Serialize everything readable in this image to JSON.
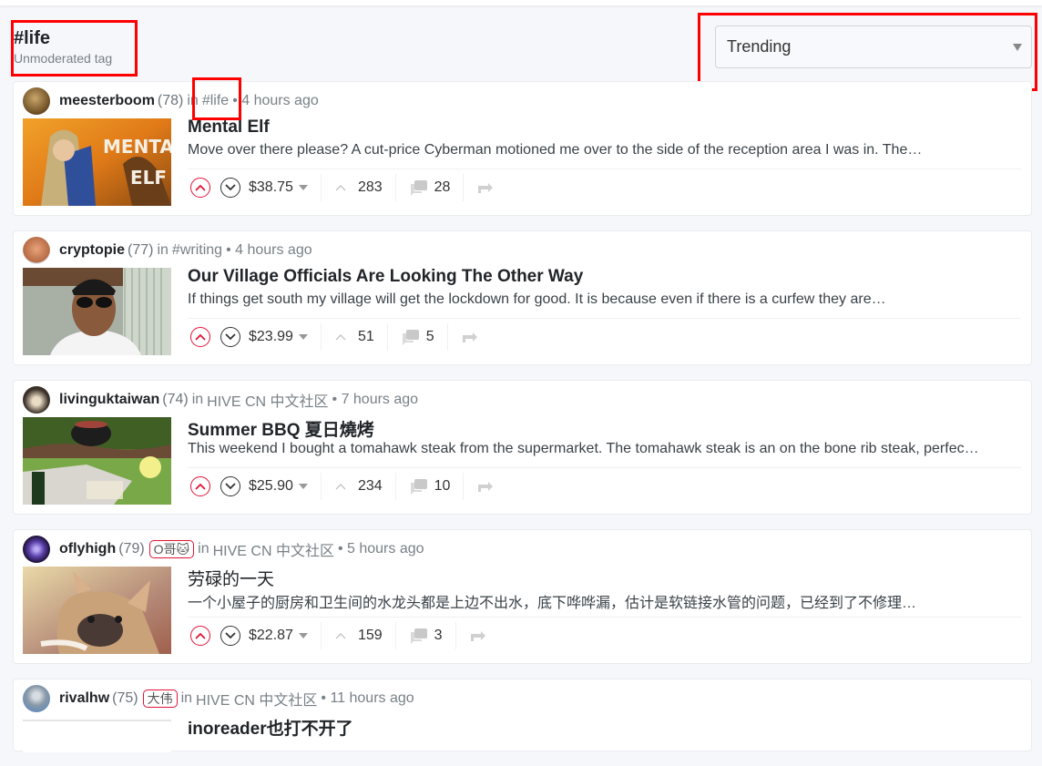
{
  "header": {
    "tag": "#life",
    "subtitle": "Unmoderated tag"
  },
  "sort": {
    "selected": "Trending"
  },
  "colors": {
    "accent": "#e31337",
    "annotation": "#ff0000"
  },
  "posts": [
    {
      "author": "meesterboom",
      "reputation": "(78)",
      "badge": null,
      "in_label": "in",
      "community": "#life",
      "time": "• 4 hours ago",
      "title": "Mental Elf",
      "summary": "Move over there please? A cut-price Cyberman motioned me over to the side of the reception area I was in. The…",
      "payout": "$38.75",
      "votes": "283",
      "comments": "28"
    },
    {
      "author": "cryptopie",
      "reputation": "(77)",
      "badge": null,
      "in_label": "in",
      "community": "#writing",
      "time": "• 4 hours ago",
      "title": "Our Village Officials Are Looking The Other Way",
      "summary": "If things get south my village will get the lockdown for good. It is because even if there is a curfew they are…",
      "payout": "$23.99",
      "votes": "51",
      "comments": "5"
    },
    {
      "author": "livinguktaiwan",
      "reputation": "(74)",
      "badge": null,
      "in_label": "in",
      "community": "HIVE CN 中文社区",
      "time": "• 7 hours ago",
      "title": "Summer BBQ 夏日燒烤",
      "summary": "This weekend I bought a tomahawk steak from the supermarket. The tomahawk steak is an on the bone rib steak, perfec…",
      "payout": "$25.90",
      "votes": "234",
      "comments": "10"
    },
    {
      "author": "oflyhigh",
      "reputation": "(79)",
      "badge": "O哥🐱",
      "in_label": "in",
      "community": "HIVE CN 中文社区",
      "time": "• 5 hours ago",
      "title": "劳碌的一天",
      "summary": "一个小屋子的厨房和卫生间的水龙头都是上边不出水，底下哗哗漏，估计是软链接水管的问题，已经到了不修理…",
      "payout": "$22.87",
      "votes": "159",
      "comments": "3"
    },
    {
      "author": "rivalhw",
      "reputation": "(75)",
      "badge": "大伟",
      "in_label": "in",
      "community": "HIVE CN 中文社区",
      "time": "• 11 hours ago",
      "title": "inoreader也打不开了",
      "summary": "",
      "payout": "",
      "votes": "",
      "comments": ""
    }
  ]
}
